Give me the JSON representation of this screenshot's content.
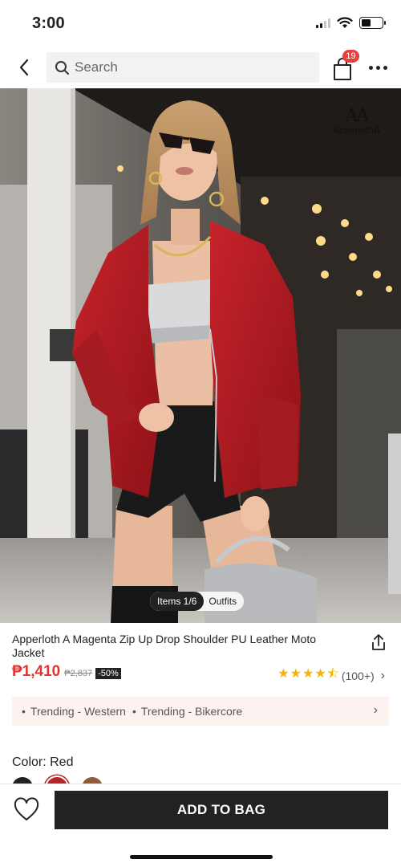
{
  "status_bar": {
    "time": "3:00"
  },
  "nav": {
    "search_placeholder": "Search",
    "bag_count": "19",
    "brand_mark": "AA",
    "brand_name": "ApperlothA"
  },
  "gallery": {
    "items_label": "Items 1/6",
    "outfits_label": "Outfits"
  },
  "product": {
    "title": "Apperloth A Magenta Zip Up Drop Shoulder PU Leather Moto Jacket",
    "price": "₱1,410",
    "original_price": "₱2,837",
    "discount": "-50%",
    "rating_stars": 4.5,
    "rating_count": "(100+)"
  },
  "tags": [
    "Trending - Western",
    "Trending - Bikercore"
  ],
  "color": {
    "label": "Color: Red",
    "swatches": [
      {
        "name": "black",
        "hex": "#222222"
      },
      {
        "name": "red",
        "hex": "#b3262b",
        "selected": true
      },
      {
        "name": "brown",
        "hex": "#8f5b3c"
      }
    ]
  },
  "actions": {
    "add_to_bag": "ADD TO BAG"
  },
  "colors": {
    "price": "#e0362f",
    "badge": "#e8403b",
    "star": "#f5b400",
    "button": "#222222"
  }
}
